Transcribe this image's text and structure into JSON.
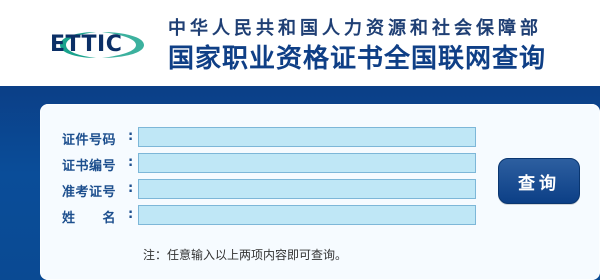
{
  "header": {
    "logo_text": "ETTIC",
    "ministry": "中华人民共和国人力资源和社会保障部",
    "title": "国家职业资格证书全国联网查询"
  },
  "form": {
    "fields": [
      {
        "label": "证件号码",
        "value": ""
      },
      {
        "label": "证书编号",
        "value": ""
      },
      {
        "label": "准考证号",
        "value": ""
      },
      {
        "label": "姓　　名",
        "value": ""
      }
    ],
    "colon": ":",
    "submit_label": "查询",
    "note": "注：任意输入以上两项内容即可查询。"
  },
  "colors": {
    "band_blue": "#0b3f87",
    "input_bg": "#bfe7f6",
    "label_blue": "#1d4f8e",
    "button_blue": "#0c3f86"
  },
  "icons": {
    "logo": "ettic-logo-icon"
  }
}
